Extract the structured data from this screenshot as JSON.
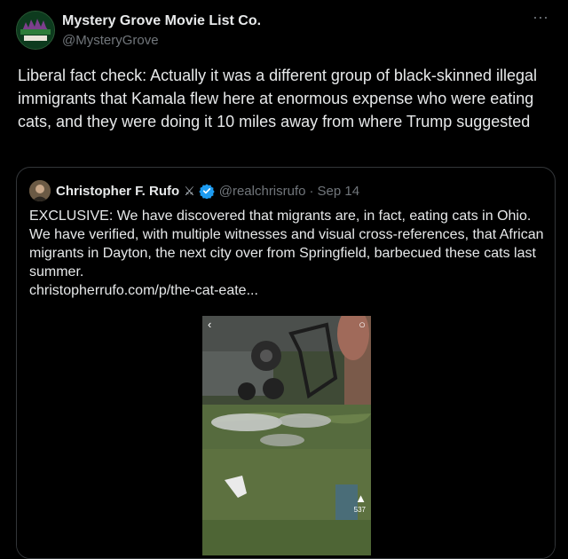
{
  "post": {
    "display_name": "Mystery Grove Movie List Co.",
    "handle": "@MysteryGrove",
    "more_icon": "more-horizontal-icon",
    "text": "Liberal fact check: Actually it was a different group of black-skinned illegal immigrants that Kamala flew here at enormous expense who were eating cats, and they were doing it 10 miles away from where Trump suggested",
    "avatar_text": "MYSTERY GROVE PUBLISHING CO."
  },
  "quote": {
    "display_name": "Christopher F. Rufo",
    "name_emoji": "⚔",
    "verified_icon": "verified-badge-icon",
    "handle": "@realchrisrufo",
    "separator": "·",
    "date": "Sep 14",
    "text": "EXCLUSIVE: We have discovered that migrants are, in fact, eating cats in Ohio. We have verified, with multiple witnesses and visual cross-references, that African migrants in Dayton, the next city over from Springfield, barbecued these cats last summer.",
    "link": "christopherrufo.com/p/the-cat-eate..."
  },
  "media": {
    "back_icon": "chevron-left-icon",
    "search_icon": "search-icon",
    "like_icon": "thumbs-up-icon",
    "like_count": "537"
  },
  "colors": {
    "background": "#000000",
    "text": "#e7e9ea",
    "secondary": "#71767b",
    "verified": "#1d9bf0",
    "border": "#333639"
  }
}
